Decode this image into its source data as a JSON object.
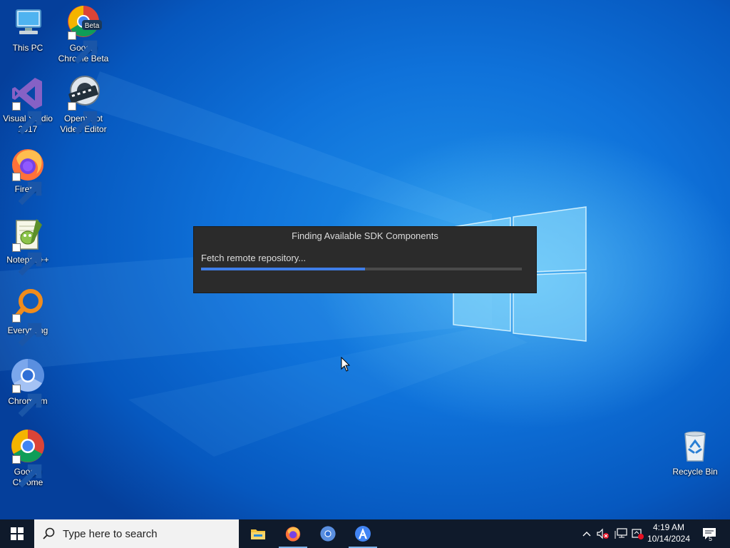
{
  "desktop": {
    "icons": [
      {
        "label": "This PC",
        "icon": "this-pc-icon"
      },
      {
        "label": "Google Chrome Beta",
        "icon": "chrome-beta-icon",
        "badge": "Beta"
      },
      {
        "label": "Visual Studio 2017",
        "icon": "visual-studio-icon"
      },
      {
        "label": "OpenShot Video Editor",
        "icon": "openshot-icon"
      },
      {
        "label": "Firefox",
        "icon": "firefox-icon"
      },
      {
        "label": "Notepad++",
        "icon": "notepad-plus-plus-icon"
      },
      {
        "label": "Everything",
        "icon": "everything-search-icon"
      },
      {
        "label": "Chromium",
        "icon": "chromium-icon"
      },
      {
        "label": "Google Chrome",
        "icon": "chrome-icon"
      },
      {
        "label": "Recycle Bin",
        "icon": "recycle-bin-icon"
      }
    ]
  },
  "dialog": {
    "title": "Finding Available SDK Components",
    "status": "Fetch remote repository...",
    "progress_percent": 51
  },
  "taskbar": {
    "search_placeholder": "Type here to search",
    "apps": [
      {
        "name": "File Explorer",
        "icon": "file-explorer-icon",
        "active": false
      },
      {
        "name": "Firefox",
        "icon": "firefox-icon",
        "active": true
      },
      {
        "name": "Chromium",
        "icon": "chromium-icon",
        "active": false
      },
      {
        "name": "Android Studio",
        "icon": "android-studio-icon",
        "active": true
      }
    ],
    "clock": {
      "time": "4:19 AM",
      "date": "10/14/2024"
    },
    "notification_count": "5"
  },
  "colors": {
    "desktop_blue": "#0f72da",
    "dialog_bg": "#2b2b2b",
    "progress_fill": "#3f7ee8",
    "taskbar_bg": "#0f1a2b"
  }
}
